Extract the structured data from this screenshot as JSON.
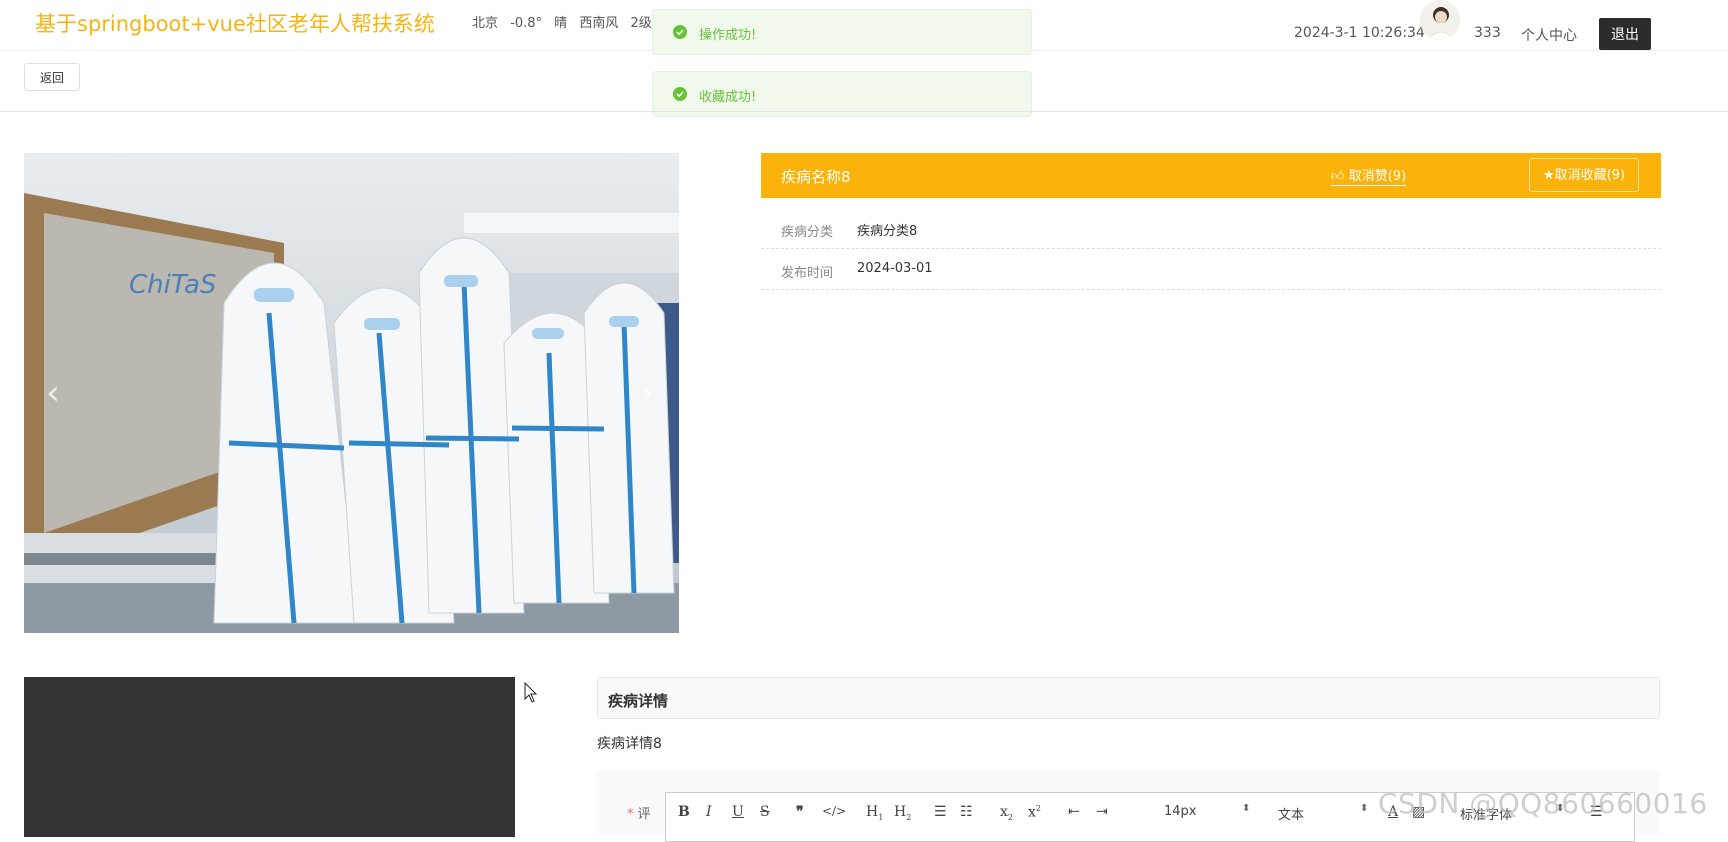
{
  "header": {
    "site_title": "基于springboot+vue社区老年人帮扶系统",
    "weather": {
      "city": "北京",
      "temperature": "-0.8°",
      "condition": "晴",
      "wind_direction": "西南风",
      "wind_level": "2级"
    },
    "datetime": "2024-3-1 10:26:34",
    "username": "333",
    "user_center_label": "个人中心",
    "logout_label": "退出"
  },
  "toasts": [
    {
      "text": "操作成功!"
    },
    {
      "text": "收藏成功!"
    }
  ],
  "nav": {
    "back_label": "返回"
  },
  "detail": {
    "title": "疾病名称8",
    "like_label": "取消赞(9)",
    "favorite_label": "取消收藏(9)",
    "fields": [
      {
        "key": "疾病分类",
        "value": "疾病分类8"
      },
      {
        "key": "发布时间",
        "value": "2024-03-01"
      }
    ],
    "section_title": "疾病详情",
    "section_text": "疾病详情8"
  },
  "comment": {
    "label": "评",
    "toolbar": {
      "font_size": "14px",
      "heading": "文本",
      "font_family": "标准字体"
    }
  },
  "colors": {
    "brand": "#f4b512",
    "title_bar": "#fbb30b",
    "success": "#67c23a"
  },
  "watermark": "CSDN @QQ860660016"
}
